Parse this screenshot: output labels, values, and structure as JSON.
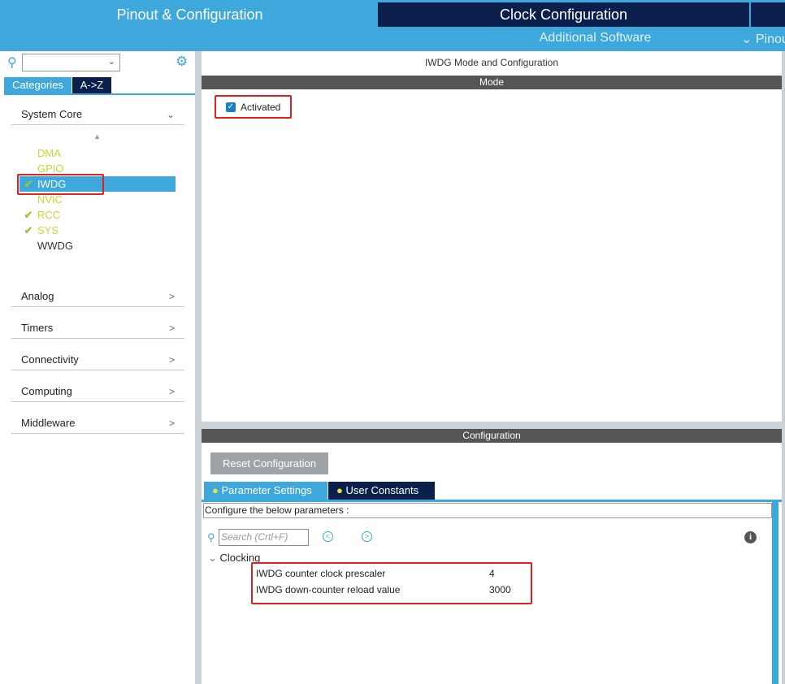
{
  "header": {
    "tabs": [
      "Pinout & Configuration",
      "Clock Configuration"
    ],
    "subtabs": [
      "Additional Software",
      "Pinout"
    ]
  },
  "sidebar": {
    "search_value": "",
    "view_tabs": [
      "Categories",
      "A->Z"
    ],
    "categories": [
      {
        "label": "System Core",
        "expanded": true
      },
      {
        "label": "Analog"
      },
      {
        "label": "Timers"
      },
      {
        "label": "Connectivity"
      },
      {
        "label": "Computing"
      },
      {
        "label": "Middleware"
      }
    ],
    "items": [
      {
        "label": "DMA",
        "checked": false
      },
      {
        "label": "GPIO",
        "checked": false
      },
      {
        "label": "IWDG",
        "checked": true,
        "selected": true
      },
      {
        "label": "NVIC",
        "checked": false
      },
      {
        "label": "RCC",
        "checked": true
      },
      {
        "label": "SYS",
        "checked": true
      },
      {
        "label": "WWDG",
        "checked": false
      }
    ]
  },
  "main": {
    "title": "IWDG Mode and Configuration",
    "mode_header": "Mode",
    "activated_label": "Activated",
    "activated": true,
    "config_header": "Configuration",
    "reset_button": "Reset Configuration",
    "config_tabs": [
      "Parameter Settings",
      "User Constants"
    ],
    "hint": "Configure the below parameters :",
    "search_placeholder": "Search (Crtl+F)",
    "group": "Clocking",
    "params": [
      {
        "name": "IWDG counter clock prescaler",
        "value": "4"
      },
      {
        "name": "IWDG down-counter reload value",
        "value": "3000"
      }
    ]
  },
  "colors": {
    "accent": "#3ea8dc",
    "navy": "#0b1f4d",
    "highlight": "#e02020"
  }
}
